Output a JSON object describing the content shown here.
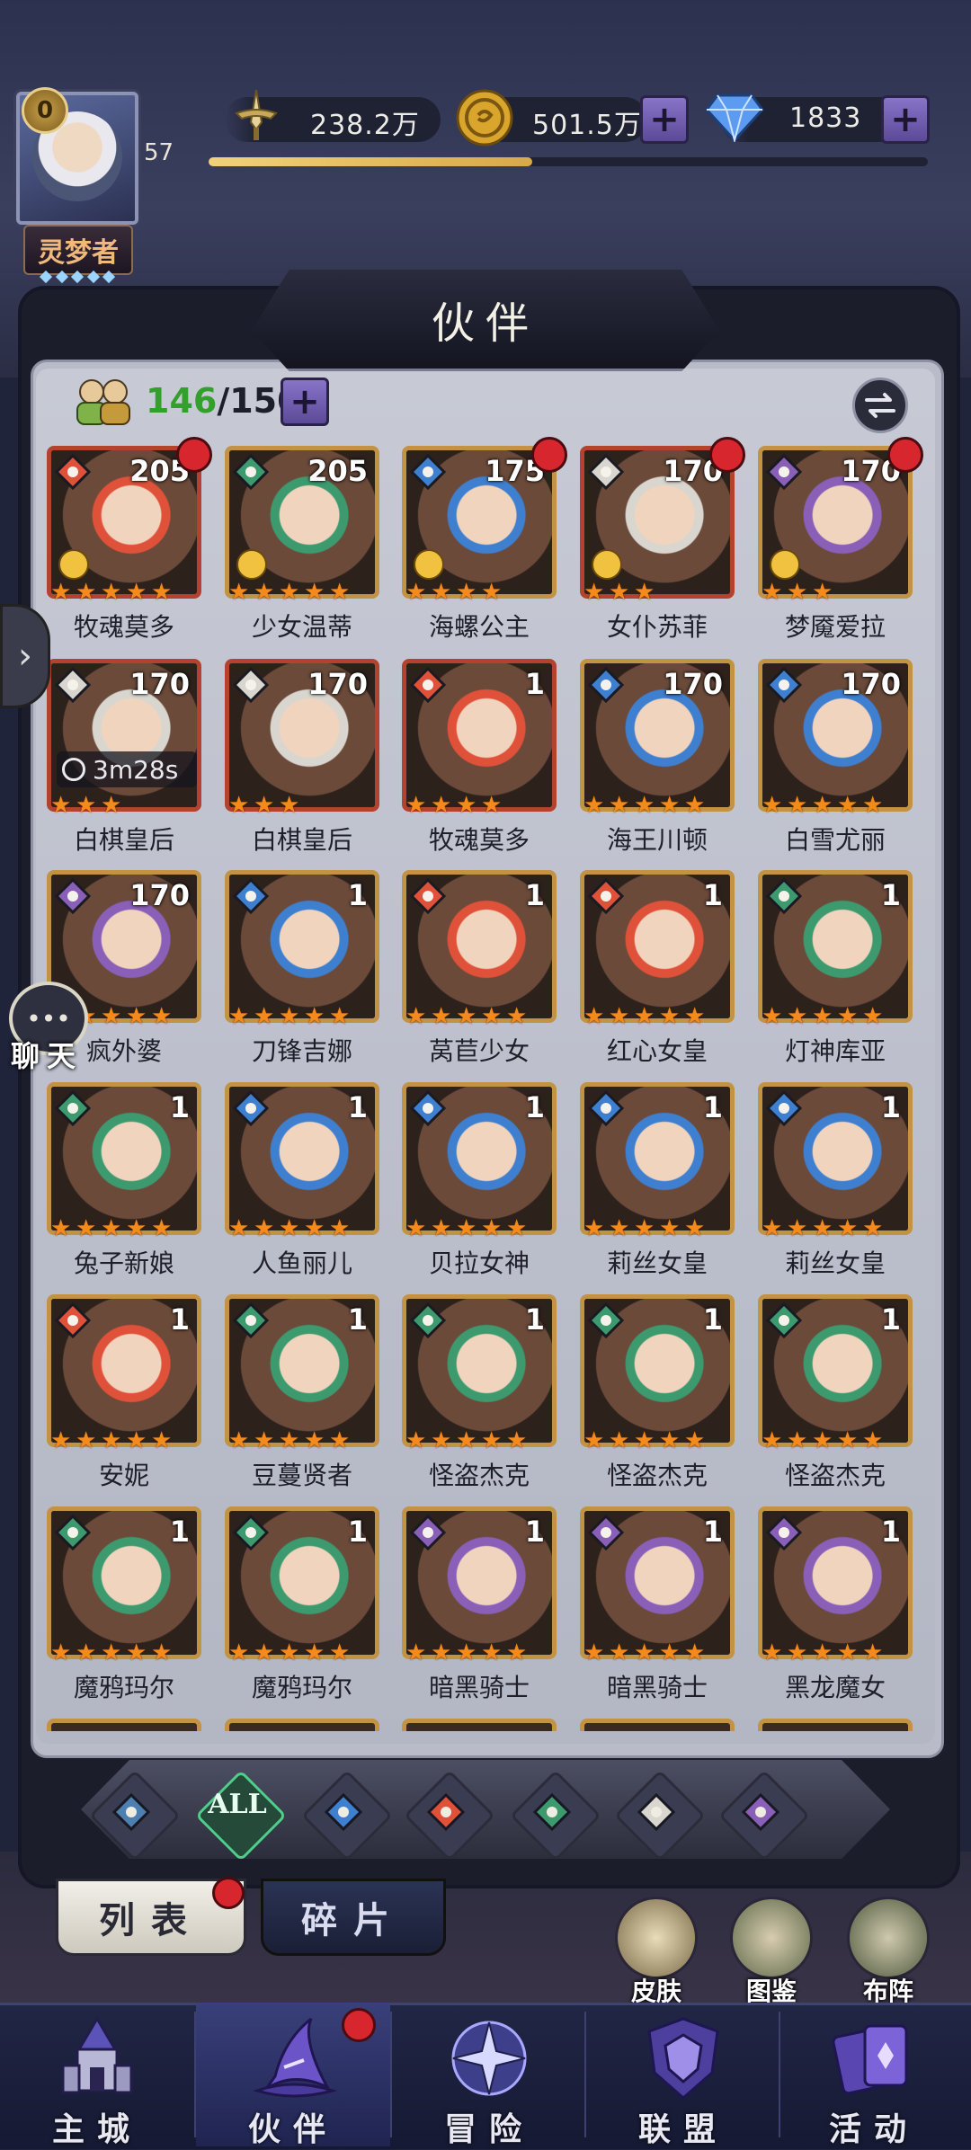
{
  "player": {
    "vip_level": "0",
    "level": "57",
    "title": "灵梦者",
    "exp_fraction": 0.45
  },
  "resources": {
    "power": "238.2万",
    "gold": "501.5万",
    "diamond": "1833",
    "plus_symbol": "+"
  },
  "panel": {
    "title": "伙伴",
    "count_current": "146",
    "count_max": "/150"
  },
  "heroes": [
    {
      "name": "牧魂莫多",
      "level": "205",
      "element": "fire",
      "stars": 5,
      "red_dot": true,
      "badge": true,
      "color": "#b3422f"
    },
    {
      "name": "少女温蒂",
      "level": "205",
      "element": "wind",
      "stars": 5,
      "red_dot": false,
      "badge": true,
      "color": "#c29343"
    },
    {
      "name": "海螺公主",
      "level": "175",
      "element": "water",
      "stars": 4,
      "red_dot": true,
      "badge": true,
      "color": "#c29343"
    },
    {
      "name": "女仆苏菲",
      "level": "170",
      "element": "light",
      "stars": 3,
      "red_dot": true,
      "badge": true,
      "color": "#b3422f"
    },
    {
      "name": "梦魇爱拉",
      "level": "170",
      "element": "dark",
      "stars": 3,
      "red_dot": true,
      "badge": true,
      "color": "#c29343"
    },
    {
      "name": "白棋皇后",
      "level": "170",
      "element": "light",
      "stars": 3,
      "red_dot": false,
      "timer": "3m28s",
      "color": "#b3422f"
    },
    {
      "name": "白棋皇后",
      "level": "170",
      "element": "light",
      "stars": 3,
      "red_dot": false,
      "color": "#b3422f"
    },
    {
      "name": "牧魂莫多",
      "level": "1",
      "element": "fire",
      "stars": 4,
      "red_dot": false,
      "color": "#b3422f"
    },
    {
      "name": "海王川顿",
      "level": "170",
      "element": "water",
      "stars": 5,
      "red_dot": false,
      "color": "#c29343"
    },
    {
      "name": "白雪尤丽",
      "level": "170",
      "element": "water",
      "stars": 5,
      "red_dot": false,
      "color": "#c29343"
    },
    {
      "name": "疯外婆",
      "level": "170",
      "element": "dark",
      "stars": 5,
      "red_dot": false,
      "color": "#c29343"
    },
    {
      "name": "刀锋吉娜",
      "level": "1",
      "element": "water",
      "stars": 5,
      "red_dot": false,
      "color": "#c29343"
    },
    {
      "name": "莴苣少女",
      "level": "1",
      "element": "fire",
      "stars": 5,
      "red_dot": false,
      "color": "#c29343"
    },
    {
      "name": "红心女皇",
      "level": "1",
      "element": "fire",
      "stars": 5,
      "red_dot": false,
      "color": "#c29343"
    },
    {
      "name": "灯神库亚",
      "level": "1",
      "element": "wind",
      "stars": 5,
      "red_dot": false,
      "color": "#c29343"
    },
    {
      "name": "兔子新娘",
      "level": "1",
      "element": "wind",
      "stars": 5,
      "red_dot": false,
      "color": "#c29343"
    },
    {
      "name": "人鱼丽儿",
      "level": "1",
      "element": "water",
      "stars": 5,
      "red_dot": false,
      "color": "#c29343"
    },
    {
      "name": "贝拉女神",
      "level": "1",
      "element": "water",
      "stars": 5,
      "red_dot": false,
      "color": "#c29343"
    },
    {
      "name": "莉丝女皇",
      "level": "1",
      "element": "water",
      "stars": 5,
      "red_dot": false,
      "color": "#c29343"
    },
    {
      "name": "莉丝女皇",
      "level": "1",
      "element": "water",
      "stars": 5,
      "red_dot": false,
      "color": "#c29343"
    },
    {
      "name": "安妮",
      "level": "1",
      "element": "fire",
      "stars": 5,
      "red_dot": false,
      "color": "#c29343"
    },
    {
      "name": "豆蔓贤者",
      "level": "1",
      "element": "wind",
      "stars": 5,
      "red_dot": false,
      "color": "#c29343"
    },
    {
      "name": "怪盗杰克",
      "level": "1",
      "element": "wind",
      "stars": 5,
      "red_dot": false,
      "color": "#c29343"
    },
    {
      "name": "怪盗杰克",
      "level": "1",
      "element": "wind",
      "stars": 5,
      "red_dot": false,
      "color": "#c29343"
    },
    {
      "name": "怪盗杰克",
      "level": "1",
      "element": "wind",
      "stars": 5,
      "red_dot": false,
      "color": "#c29343"
    },
    {
      "name": "魔鸦玛尔",
      "level": "1",
      "element": "wind",
      "stars": 5,
      "red_dot": false,
      "color": "#c29343"
    },
    {
      "name": "魔鸦玛尔",
      "level": "1",
      "element": "wind",
      "stars": 5,
      "red_dot": false,
      "color": "#c29343"
    },
    {
      "name": "暗黑骑士",
      "level": "1",
      "element": "dark",
      "stars": 5,
      "red_dot": false,
      "color": "#c29343"
    },
    {
      "name": "暗黑骑士",
      "level": "1",
      "element": "dark",
      "stars": 5,
      "red_dot": false,
      "color": "#c29343"
    },
    {
      "name": "黑龙魔女",
      "level": "1",
      "element": "dark",
      "stars": 5,
      "red_dot": false,
      "color": "#c29343"
    }
  ],
  "element_colors": {
    "fire": "#e0513a",
    "water": "#3f7fd0",
    "wind": "#3c9a6e",
    "light": "#d8d6cf",
    "dark": "#8a5fb8",
    "all": "#4ecf8a"
  },
  "filters": [
    {
      "id": "cross",
      "label": ""
    },
    {
      "id": "all",
      "label": "ALL"
    },
    {
      "id": "water",
      "label": ""
    },
    {
      "id": "fire",
      "label": ""
    },
    {
      "id": "wind",
      "label": ""
    },
    {
      "id": "light",
      "label": ""
    },
    {
      "id": "dark",
      "label": ""
    }
  ],
  "tabs": {
    "list": "列表",
    "fragments": "碎片"
  },
  "quick_actions": {
    "skin": "皮肤",
    "codex": "图鉴",
    "formation": "布阵"
  },
  "side": {
    "chat": "聊天"
  },
  "nav": {
    "castle": "主城",
    "partner": "伙伴",
    "adventure": "冒险",
    "alliance": "联盟",
    "activity": "活动"
  }
}
